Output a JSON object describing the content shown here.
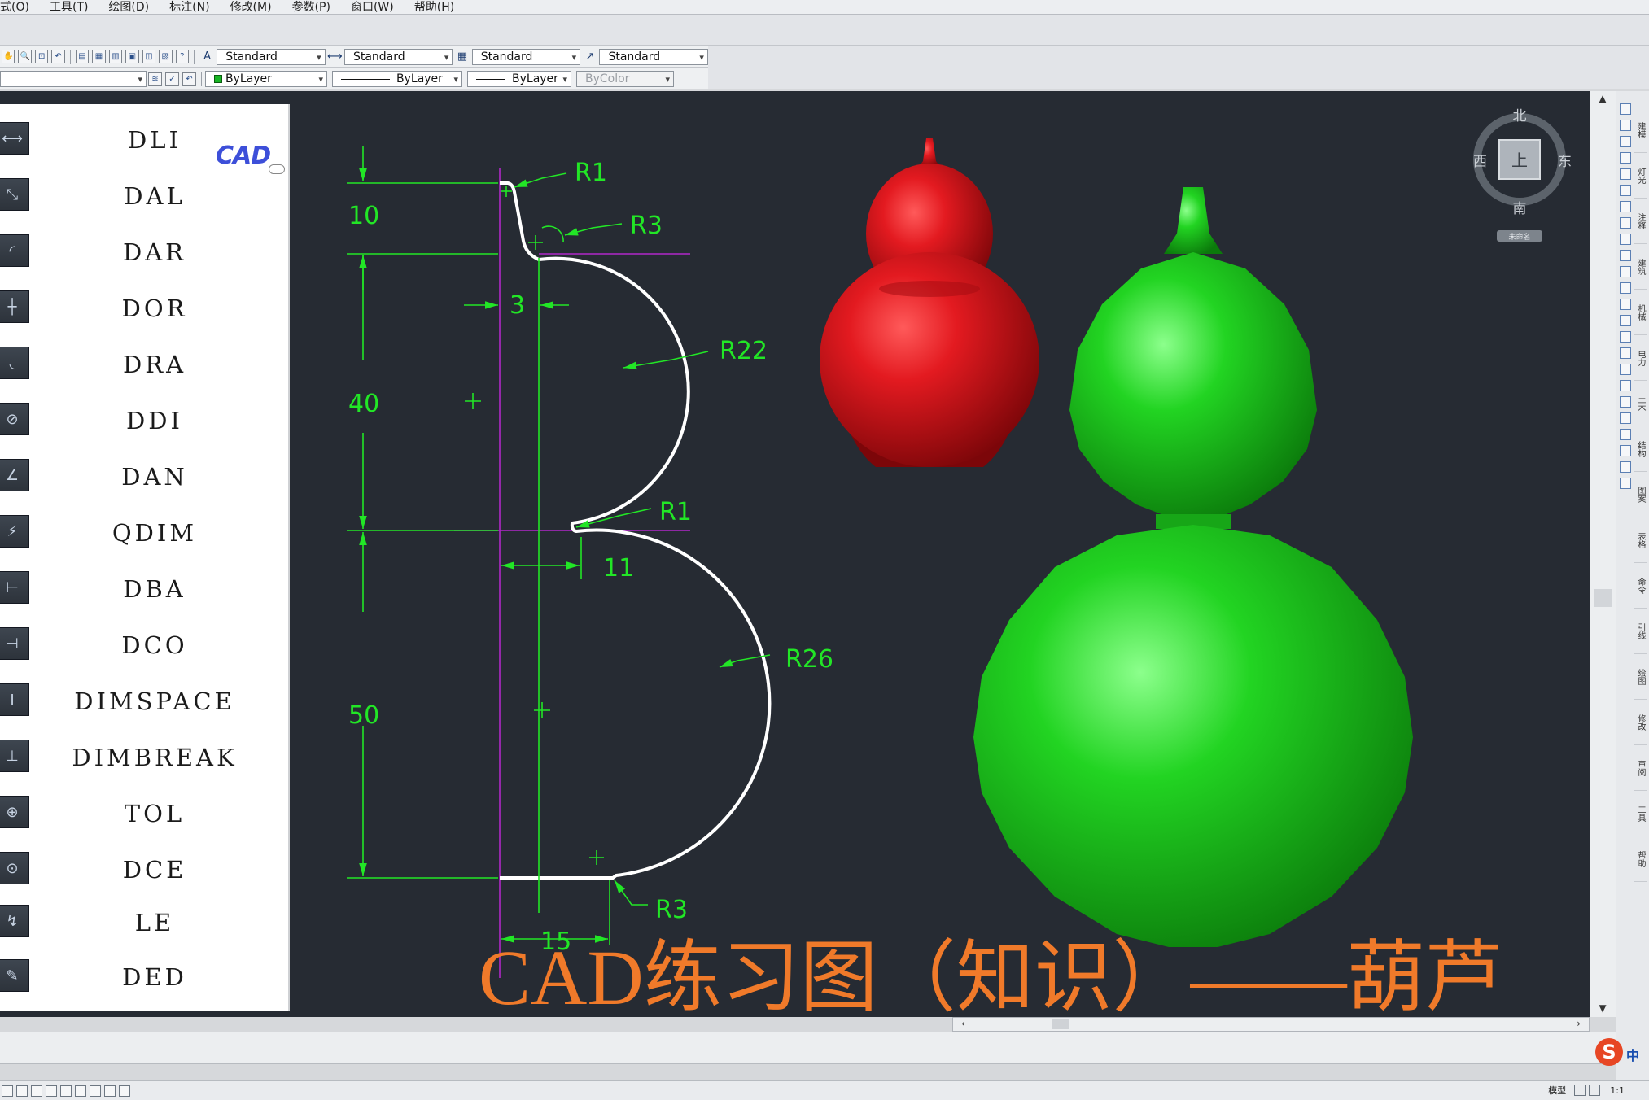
{
  "menu": [
    "式(O)",
    "工具(T)",
    "绘图(D)",
    "标注(N)",
    "修改(M)",
    "参数(P)",
    "窗口(W)",
    "帮助(H)"
  ],
  "toolbar": {
    "text_style": "Standard",
    "dim_style": "Standard",
    "table_style": "Standard",
    "multileader_style": "Standard",
    "color": "ByLayer",
    "linetype": "ByLayer",
    "lineweight": "ByLayer",
    "plot_style": "ByColor"
  },
  "commands": [
    "DLI",
    "DAL",
    "DAR",
    "DOR",
    "DRA",
    "DDI",
    "DAN",
    "QDIM",
    "DBA",
    "DCO",
    "DIMSPACE",
    "DIMBREAK",
    "TOL",
    "DCE",
    "LE",
    "DED"
  ],
  "logo_text": "CAD",
  "drawing": {
    "dims": {
      "d10": "10",
      "d40": "40",
      "d50": "50",
      "d3": "3",
      "d11": "11",
      "d15": "15",
      "r1_top": "R1",
      "r3_top": "R3",
      "r22": "R22",
      "r1_mid": "R1",
      "r26": "R26",
      "r3_bot": "R3"
    },
    "caption": "CAD练习图（知识）——葫芦",
    "colors": {
      "dimension": "#22e626",
      "profile": "#ffffff",
      "centerline": "#b027c9",
      "caption": "#f07a2a",
      "gourd_red": "#d8141c",
      "gourd_green": "#1ecb1e",
      "background": "#262b33"
    }
  },
  "viewcube": {
    "north": "北",
    "south": "南",
    "east": "东",
    "west": "西",
    "top": "上",
    "wcs": "未命名"
  },
  "right_tabs": [
    "建模",
    "灯光",
    "注释",
    "建筑",
    "机械",
    "电力",
    "土木",
    "结构",
    "图案",
    "表格",
    "命令",
    "引线",
    "绘图",
    "修改",
    "审阅",
    "工具",
    "帮助"
  ],
  "status": {
    "model": "模型",
    "scale": "1:1"
  },
  "ime": {
    "logo": "S",
    "lang": "中"
  }
}
